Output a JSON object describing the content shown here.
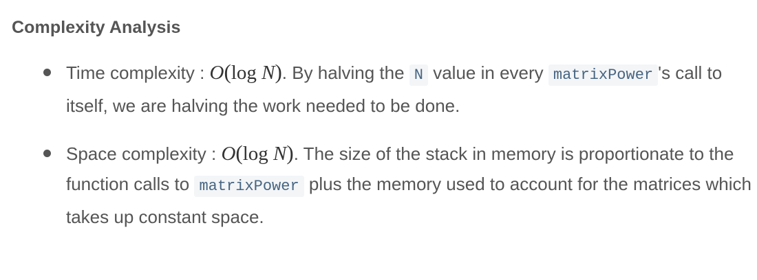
{
  "heading": "Complexity Analysis",
  "items": [
    {
      "label": "Time complexity : ",
      "math": {
        "O": "O",
        "log": "log",
        "N": "N"
      },
      "text_a": ". By halving the ",
      "code_a": "N",
      "text_b": " value in every ",
      "code_b": "matrixPower",
      "text_c": "'s call to itself, we are halving the work needed to be done."
    },
    {
      "label": "Space complexity : ",
      "math": {
        "O": "O",
        "log": "log",
        "N": "N"
      },
      "text_a": ". The size of the stack in memory is proportionate to the function calls to ",
      "code_a": "matrixPower",
      "text_b": " plus the memory used to account for the matrices which takes up constant space."
    }
  ]
}
